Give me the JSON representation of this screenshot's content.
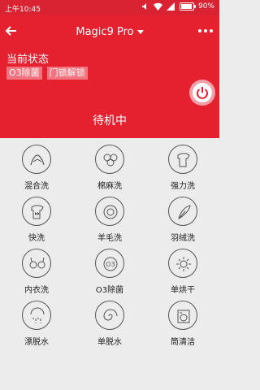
{
  "status_bar": {
    "time": "上午10:45",
    "battery": "90%",
    "battery_level": 0.9
  },
  "header": {
    "title": "Magic9 Pro",
    "status_label": "当前状态",
    "tags": [
      "O3除菌",
      "门锁解锁"
    ],
    "state": "待机中"
  },
  "modes": [
    {
      "label": "混合洗",
      "icon": "mixed-wash-icon"
    },
    {
      "label": "棉麻洗",
      "icon": "cotton-icon"
    },
    {
      "label": "强力洗",
      "icon": "heavy-shirt-icon"
    },
    {
      "label": "快洗",
      "icon": "quick-wash-icon"
    },
    {
      "label": "羊毛洗",
      "icon": "wool-icon"
    },
    {
      "label": "羽绒洗",
      "icon": "feather-icon"
    },
    {
      "label": "内衣洗",
      "icon": "underwear-icon"
    },
    {
      "label": "O3除菌",
      "icon": "o3-sterilize-icon"
    },
    {
      "label": "单烘干",
      "icon": "sun-dry-icon"
    },
    {
      "label": "漂脱水",
      "icon": "rinse-spin-icon"
    },
    {
      "label": "单脱水",
      "icon": "spin-icon"
    },
    {
      "label": "筒清洁",
      "icon": "drum-clean-icon"
    }
  ],
  "colors": {
    "brand_red": "#e5202f",
    "tag_bg": "#f3737e",
    "background": "#ececec"
  }
}
